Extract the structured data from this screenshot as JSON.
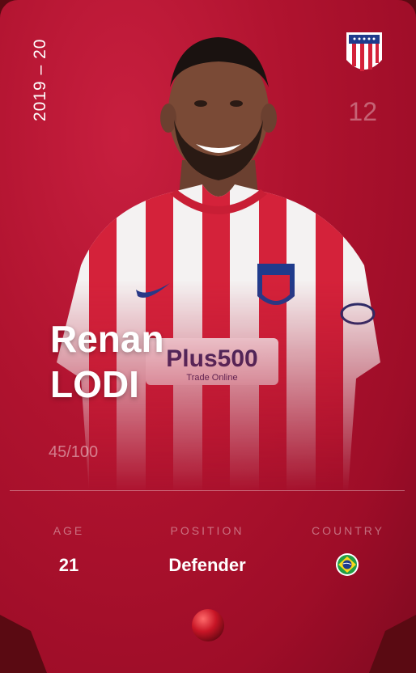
{
  "card": {
    "season": "2019 – 20",
    "shirt_number": "12",
    "first_name": "Renan",
    "last_name": "LODI",
    "serial": "45/100",
    "colors": {
      "primary": "#b0132f",
      "dark": "#5a0a12"
    }
  },
  "club": {
    "badge_icon": "atletico-madrid-crest-icon"
  },
  "stats": {
    "age_label": "AGE",
    "age_value": "21",
    "position_label": "POSITION",
    "position_value": "Defender",
    "country_label": "COUNTRY",
    "country_flag_icon": "brazil-flag-icon"
  },
  "rarity": {
    "icon": "rare-red-orb-icon"
  }
}
